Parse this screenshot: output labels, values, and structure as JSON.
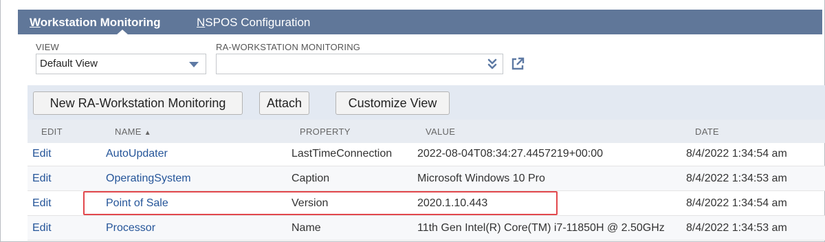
{
  "tabs": [
    {
      "label": "Workstation Monitoring",
      "accesskey": "W",
      "rest": "orkstation Monitoring",
      "active": true
    },
    {
      "label": "NSPOS Configuration",
      "accesskey": "N",
      "rest": "SPOS Configuration",
      "active": false
    }
  ],
  "filters": {
    "view_label": "VIEW",
    "view_value": "Default View",
    "record_label": "RA-WORKSTATION MONITORING",
    "record_value": ""
  },
  "toolbar": {
    "new_label": "New RA-Workstation Monitoring",
    "attach_label": "Attach",
    "customize_label": "Customize View"
  },
  "columns": {
    "edit": "EDIT",
    "name": "NAME",
    "name_sort": "▲",
    "property": "PROPERTY",
    "value": "VALUE",
    "date": "DATE"
  },
  "rows": [
    {
      "edit": "Edit",
      "name": "AutoUpdater",
      "property": "LastTimeConnection",
      "value": "2022-08-04T08:34:27.4457219+00:00",
      "date": "8/4/2022 1:34:54 am"
    },
    {
      "edit": "Edit",
      "name": "OperatingSystem",
      "property": "Caption",
      "value": "Microsoft Windows 10 Pro",
      "date": "8/4/2022 1:34:53 am"
    },
    {
      "edit": "Edit",
      "name": "Point of Sale",
      "property": "Version",
      "value": "2020.1.10.443",
      "date": "8/4/2022 1:34:54 am"
    },
    {
      "edit": "Edit",
      "name": "Processor",
      "property": "Name",
      "value": "11th Gen Intel(R) Core(TM) i7-11850H @ 2.50GHz",
      "date": "8/4/2022 1:34:53 am"
    }
  ],
  "colors": {
    "tabbar": "#607799",
    "link": "#255599",
    "highlight": "#e2474c",
    "toolbar_bg": "#e3e9f2"
  },
  "icons": {
    "view_caret": "caret-down-icon",
    "record_chevron": "double-chevron-down-icon",
    "open_external": "external-link-icon"
  }
}
